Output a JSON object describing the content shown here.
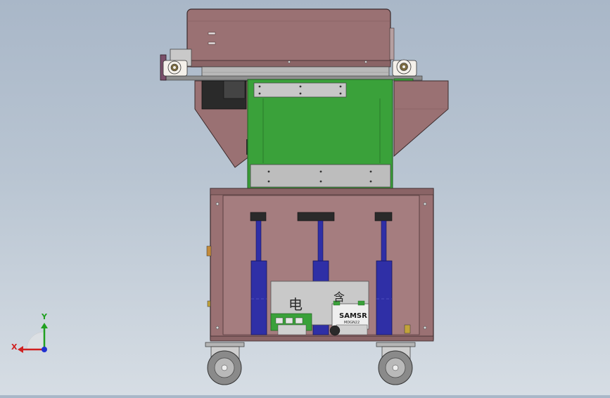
{
  "viewport": {
    "background_top": "#a9b7c8",
    "background_bottom": "#d6dde4"
  },
  "colors": {
    "housing": "#9a7173",
    "housing_dark": "#6e4f52",
    "green_panel": "#3aa13a",
    "green_dark": "#2a7a2a",
    "steel": "#b9b9b9",
    "cylinder_blue": "#2f2fa6",
    "wheel_grey": "#8a8a8a",
    "axis_x": "#d02020",
    "axis_y": "#20a020",
    "axis_z": "#2030d0"
  },
  "triad": {
    "x_label": "X",
    "y_label": "Y"
  },
  "labels": {
    "brand": "SAMSR",
    "model": "MDGN22",
    "glyph_left": "电",
    "glyph_right": "含"
  }
}
